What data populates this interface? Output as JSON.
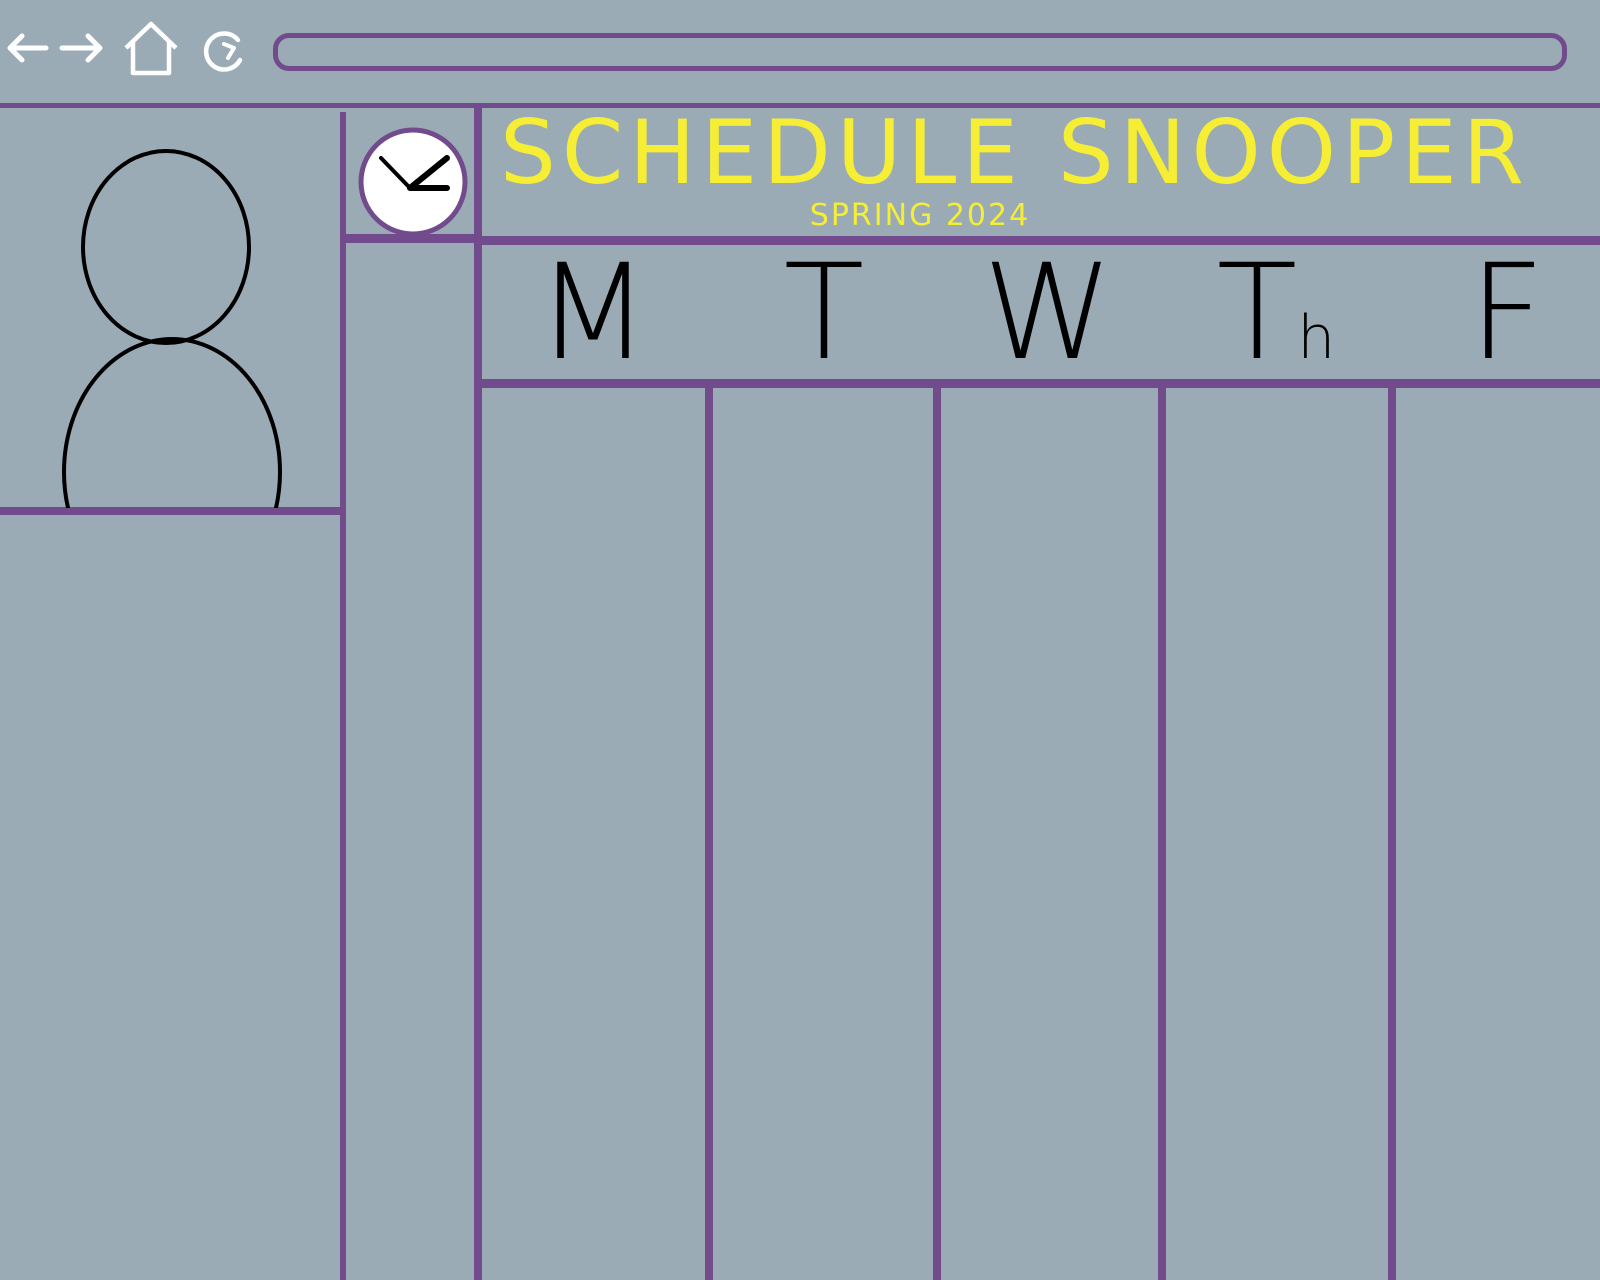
{
  "browser": {
    "back_icon": "arrow-left-icon",
    "forward_icon": "arrow-right-icon",
    "home_icon": "home-icon",
    "reload_icon": "reload-icon",
    "url_value": ""
  },
  "app": {
    "title": "SCHEDULE SNOOPER",
    "subtitle": "SPRING 2024",
    "clock_icon": "clock-icon",
    "avatar_icon": "user-avatar-icon"
  },
  "schedule": {
    "days": [
      {
        "label": "M",
        "sub": ""
      },
      {
        "label": "T",
        "sub": ""
      },
      {
        "label": "W",
        "sub": ""
      },
      {
        "label": "T",
        "sub": "h"
      },
      {
        "label": "F",
        "sub": ""
      }
    ]
  },
  "colors": {
    "background": "#9aabb5",
    "divider": "#714b8c",
    "title": "#f5ee35",
    "nav_icons": "#ffffff",
    "day_labels": "#000000"
  }
}
